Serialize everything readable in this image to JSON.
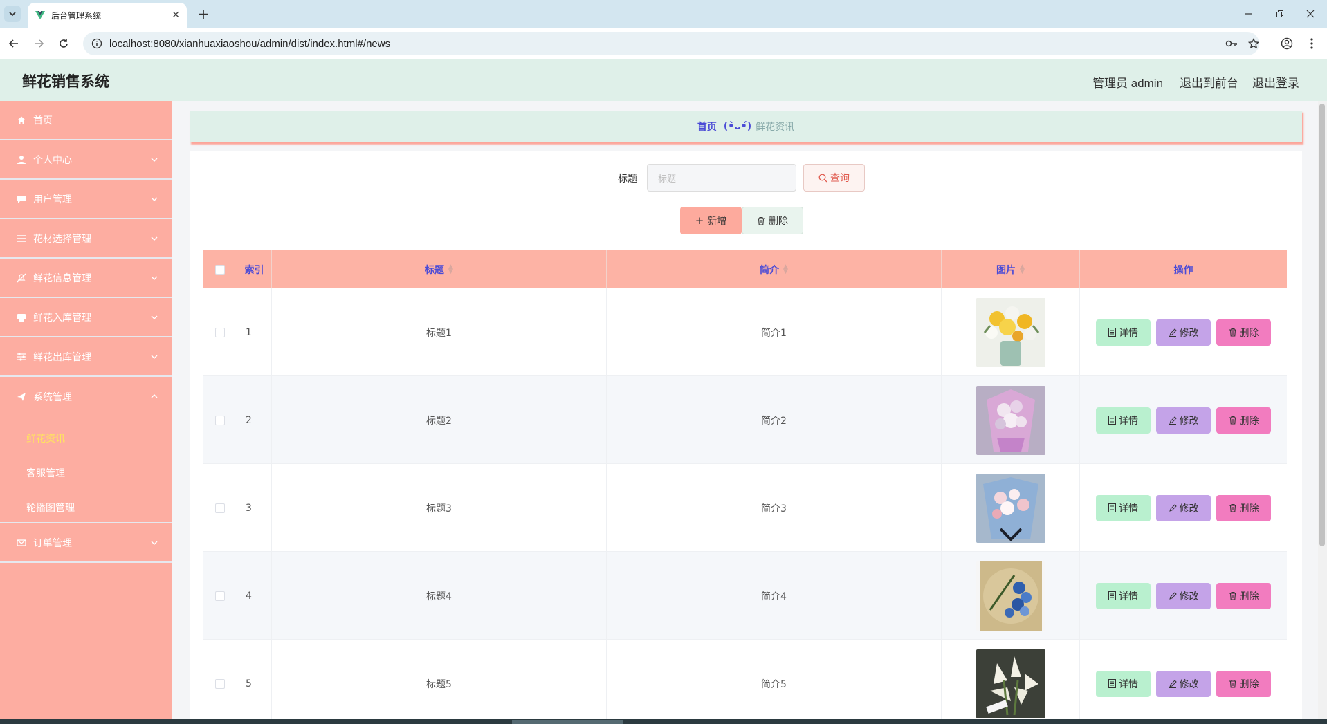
{
  "browser": {
    "tab_title": "后台管理系统",
    "url": "localhost:8080/xianhuaxiaoshou/admin/dist/index.html#/news"
  },
  "header": {
    "title": "鲜花销售系统",
    "admin_label": "管理员 admin",
    "front_label": "退出到前台",
    "logout_label": "退出登录"
  },
  "sidebar": {
    "items": [
      {
        "label": "首页",
        "icon": "home-icon",
        "expandable": false
      },
      {
        "label": "个人中心",
        "icon": "user-icon",
        "expandable": true
      },
      {
        "label": "用户管理",
        "icon": "chat-icon",
        "expandable": true
      },
      {
        "label": "花材选择管理",
        "icon": "list-icon",
        "expandable": true
      },
      {
        "label": "鲜花信息管理",
        "icon": "bell-off-icon",
        "expandable": true
      },
      {
        "label": "鲜花入库管理",
        "icon": "box-icon",
        "expandable": true
      },
      {
        "label": "鲜花出库管理",
        "icon": "sliders-icon",
        "expandable": true
      },
      {
        "label": "系统管理",
        "icon": "send-icon",
        "expandable": true,
        "expanded": true
      },
      {
        "label": "订单管理",
        "icon": "mail-icon",
        "expandable": true
      }
    ],
    "system_submenu": [
      {
        "label": "鲜花资讯",
        "active": true
      },
      {
        "label": "客服管理",
        "active": false
      },
      {
        "label": "轮播图管理",
        "active": false
      }
    ],
    "active_color": "#ffe65c"
  },
  "breadcrumb": {
    "home": "首页",
    "face": "(•̀ᴗ•́)",
    "current": "鲜花资讯"
  },
  "search": {
    "label": "标题",
    "placeholder": "标题",
    "button_label": "查询"
  },
  "actions": {
    "add_label": "新增",
    "delete_label": "删除"
  },
  "table": {
    "columns": [
      "索引",
      "标题",
      "简介",
      "图片",
      "操作"
    ],
    "row_buttons": {
      "detail": "详情",
      "edit": "修改",
      "delete": "删除"
    },
    "rows": [
      {
        "index": "1",
        "title": "标题1",
        "intro": "简介1",
        "image": "yellow-white-bouquet"
      },
      {
        "index": "2",
        "title": "标题2",
        "intro": "简介2",
        "image": "pink-bouquet"
      },
      {
        "index": "3",
        "title": "标题3",
        "intro": "简介3",
        "image": "blue-pink-bouquet"
      },
      {
        "index": "4",
        "title": "标题4",
        "intro": "简介4",
        "image": "blue-rose-hat-box"
      },
      {
        "index": "5",
        "title": "标题5",
        "intro": "简介5",
        "image": "white-lily-bouquet"
      }
    ]
  },
  "colors": {
    "sidebar": "#fdada1",
    "header": "#dff0e9",
    "table_header": "#fdb3a5",
    "link": "#4b4bd6",
    "detail_button": "#b9f0cf",
    "edit_button": "#c4a3e8",
    "delete_button": "#f27cbf"
  }
}
